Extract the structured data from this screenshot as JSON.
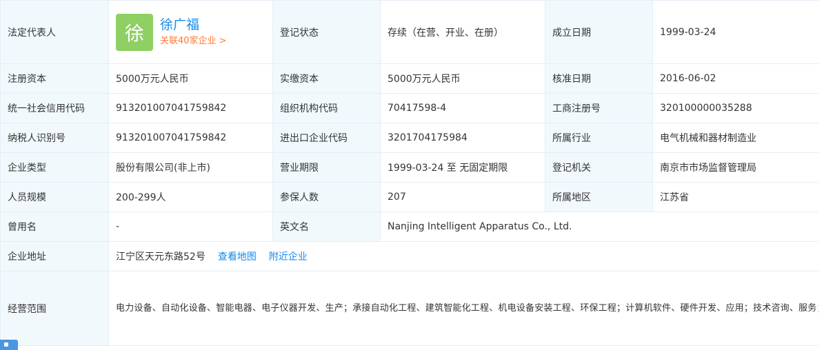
{
  "rows": {
    "legal_rep": {
      "label": "法定代表人",
      "avatar_char": "徐",
      "name": "徐广福",
      "related": "关联40家企业 >",
      "status_label": "登记状态",
      "status_value": "存续（在营、开业、在册）",
      "founded_label": "成立日期",
      "founded_value": "1999-03-24"
    },
    "capital": {
      "label": "注册资本",
      "value": "5000万元人民币",
      "paid_label": "实缴资本",
      "paid_value": "5000万元人民币",
      "approved_label": "核准日期",
      "approved_value": "2016-06-02"
    },
    "credit": {
      "label": "统一社会信用代码",
      "value": "913201007041759842",
      "org_label": "组织机构代码",
      "org_value": "70417598-4",
      "reg_label": "工商注册号",
      "reg_value": "320100000035288"
    },
    "tax": {
      "label": "纳税人识别号",
      "value": "913201007041759842",
      "ie_label": "进出口企业代码",
      "ie_value": "3201704175984",
      "industry_label": "所属行业",
      "industry_value": "电气机械和器材制造业"
    },
    "type": {
      "label": "企业类型",
      "value": "股份有限公司(非上市)",
      "term_label": "营业期限",
      "term_value": "1999-03-24 至 无固定期限",
      "authority_label": "登记机关",
      "authority_value": "南京市市场监督管理局"
    },
    "staff": {
      "label": "人员规模",
      "value": "200-299人",
      "insured_label": "参保人数",
      "insured_value": "207",
      "region_label": "所属地区",
      "region_value": "江苏省"
    },
    "former": {
      "label": "曾用名",
      "value": "-",
      "en_label": "英文名",
      "en_value": "Nanjing Intelligent Apparatus Co., Ltd."
    },
    "address": {
      "label": "企业地址",
      "value": "江宁区天元东路52号",
      "map_link": "查看地图",
      "nearby_link": "附近企业"
    },
    "scope": {
      "label": "经营范围",
      "value": "电力设备、自动化设备、智能电器、电子仪器开发、生产；承接自动化工程、建筑智能化工程、机电设备安装工程、环保工程；计算机软件、硬件开发、应用；技术咨询、服务；机电设备维保；自有房屋租赁；物业管理；经营本企业自产产品及技术的出口业务；经营本企业生产、科研、工程所需的原辅材料、仪器仪表、机械设备、零配件及技术的进口业务（国家限定公司经营和国家禁止进出口的商品及技术除外）；经营进料加工和“三来一补”业务。（依法须经批准的项目，经相关部门批准后方可开展经营活动）"
    }
  },
  "colors": {
    "label_bg": "#f2f9fc",
    "border": "#e4eef6",
    "link": "#128bed",
    "related": "#fd7a37",
    "avatar_bg": "#8fcf63"
  }
}
